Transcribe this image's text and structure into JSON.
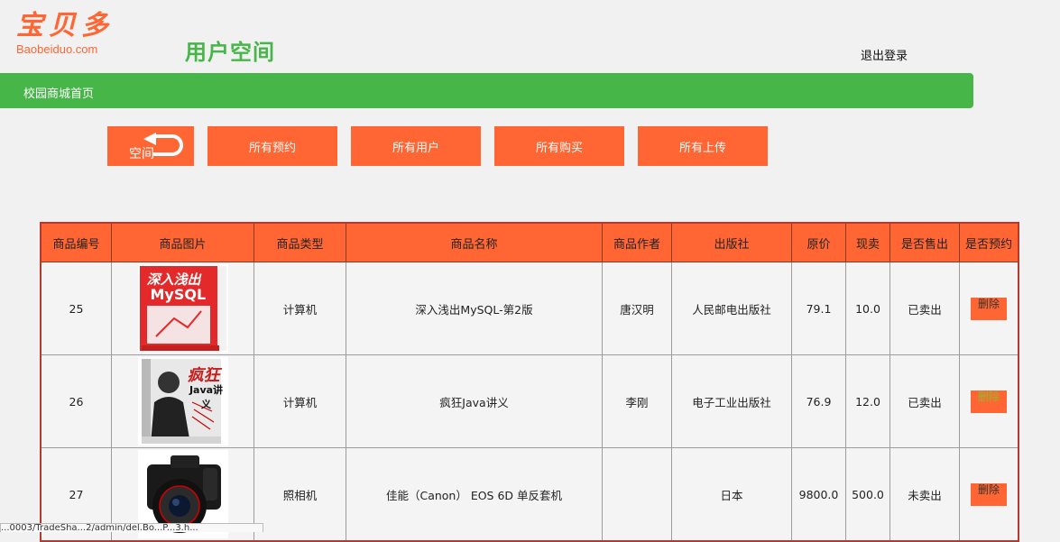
{
  "logo": {
    "cn": "宝贝多",
    "en": "Baobeiduo.com"
  },
  "page_title": "用户空间",
  "logout_label": "退出登录",
  "nav": {
    "home_label": "校园商城首页"
  },
  "buttons": {
    "back_label": "空间",
    "all_reservations": "所有预约",
    "all_users": "所有用户",
    "all_purchases": "所有购买",
    "all_uploads": "所有上传"
  },
  "table": {
    "headers": [
      "商品编号",
      "商品图片",
      "商品类型",
      "商品名称",
      "商品作者",
      "出版社",
      "原价",
      "现卖",
      "是否售出",
      "是否预约"
    ],
    "rows": [
      {
        "id": "25",
        "image": "mysql-book-cover",
        "type": "计算机",
        "name": "深入浅出MySQL-第2版",
        "author": "唐汉明",
        "publisher": "人民邮电出版社",
        "price": "79.1",
        "sale": "10.0",
        "sold": "已卖出",
        "action": "删除"
      },
      {
        "id": "26",
        "image": "java-book-cover",
        "type": "计算机",
        "name": "疯狂Java讲义",
        "author": "李刚",
        "publisher": "电子工业出版社",
        "price": "76.9",
        "sale": "12.0",
        "sold": "已卖出",
        "action": "删除"
      },
      {
        "id": "27",
        "image": "canon-camera-photo",
        "type": "照相机",
        "name": "佳能（Canon） EOS 6D 单反套机",
        "author": "",
        "publisher": "日本",
        "price": "9800.0",
        "sale": "500.0",
        "sold": "未卖出",
        "action": "删除"
      }
    ]
  },
  "cover_text": {
    "mysql_title": "深入浅出",
    "mysql_sub": "MySQL",
    "java_title": "疯狂",
    "java_sub": "Java讲义"
  },
  "status_bar": "...0003/TradeSha...2/admin/del.Bo...P...3.h...",
  "colors": {
    "accent": "#ff6633",
    "green": "#46b649",
    "table_border": "#b33a2c"
  }
}
